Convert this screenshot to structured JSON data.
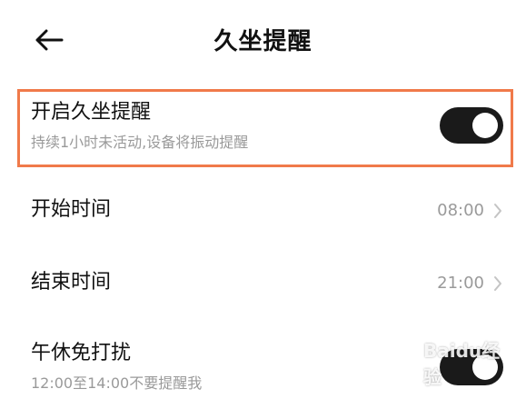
{
  "header": {
    "back_icon": "arrow-left-icon",
    "title": "久坐提醒"
  },
  "settings": [
    {
      "title": "开启久坐提醒",
      "subtitle": "持续1小时未活动,设备将振动提醒",
      "control": "toggle",
      "enabled": true,
      "highlighted": true
    },
    {
      "title": "开始时间",
      "value": "08:00",
      "control": "chevron"
    },
    {
      "title": "结束时间",
      "value": "21:00",
      "control": "chevron"
    },
    {
      "title": "午休免打扰",
      "subtitle": "12:00至14:00不要提醒我",
      "control": "toggle",
      "enabled": true
    }
  ],
  "colors": {
    "highlight_border": "#f07a4a",
    "toggle_on": "#1a1a1a",
    "secondary_text": "#9a9a9a"
  },
  "watermark": "Baidu经验"
}
